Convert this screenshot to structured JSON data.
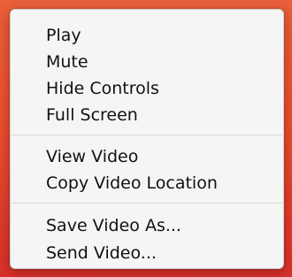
{
  "menu": {
    "groups": [
      {
        "items": [
          {
            "label": "Play"
          },
          {
            "label": "Mute"
          },
          {
            "label": "Hide Controls"
          },
          {
            "label": "Full Screen"
          }
        ]
      },
      {
        "items": [
          {
            "label": "View Video"
          },
          {
            "label": "Copy Video Location"
          }
        ]
      },
      {
        "items": [
          {
            "label": "Save Video As..."
          },
          {
            "label": "Send Video..."
          }
        ]
      }
    ]
  }
}
